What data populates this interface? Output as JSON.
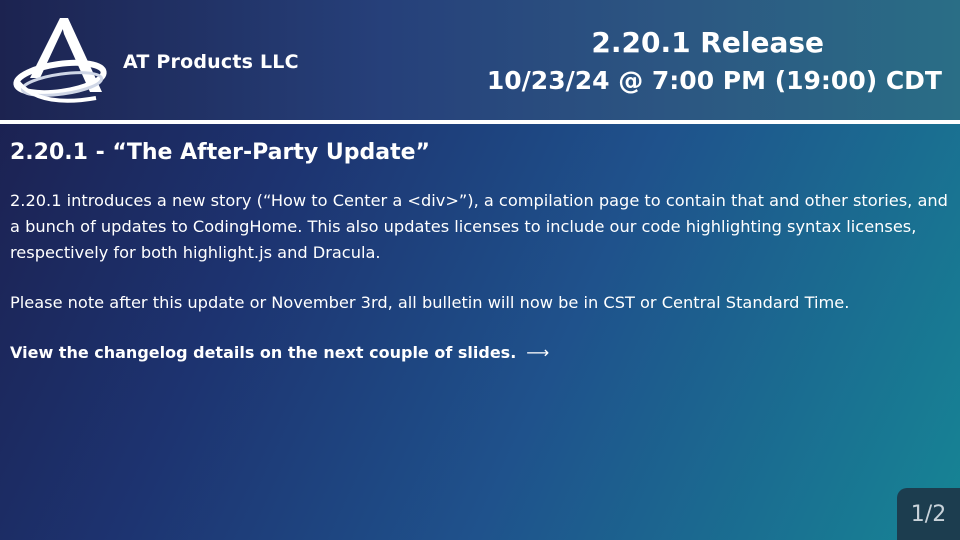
{
  "header": {
    "company_name": "AT Products LLC",
    "release_title": "2.20.1 Release",
    "release_date": "10/23/24 @ 7:00 PM (19:00) CDT"
  },
  "content": {
    "title": "2.20.1 - “The After-Party Update”",
    "paragraph_1": "2.20.1 introduces a new story (“How to Center a <div>”), a compilation page to contain that and other stories, and a bunch of updates to CodingHome. This also updates licenses to include our code highlighting syntax licenses, respectively for both highlight.js and Dracula.",
    "paragraph_2": "Please note after this update or November 3rd, all bulletin will now be in CST or Central Standard Time.",
    "cta_text": "View the changelog details on the next couple of slides.",
    "cta_arrow": "⟶"
  },
  "page_indicator": "1/2",
  "colors": {
    "background_start": "#1b1f4d",
    "background_end": "#168595",
    "header_rule": "#ffffff",
    "page_badge": "#1c3d4f"
  },
  "icons": {
    "logo": "at-products-logo"
  }
}
